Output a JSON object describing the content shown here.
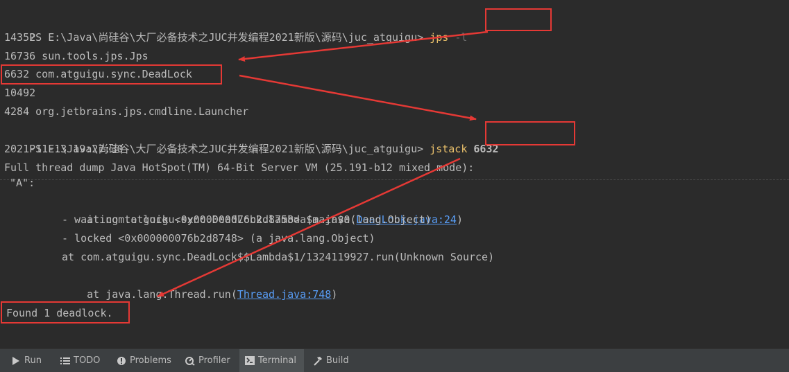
{
  "terminal": {
    "prompt": "PS E:\\Java\\尚硅谷\\大厂必备技术之JUC并发编程2021新版\\源码\\juc_atguigu>",
    "cmd1": {
      "name": "jps",
      "arg": "-l"
    },
    "jps_output": [
      "14352",
      "16736 sun.tools.jps.Jps",
      "6632 com.atguigu.sync.DeadLock",
      "10492",
      "4284 org.jetbrains.jps.cmdline.Launcher"
    ],
    "cmd2": {
      "name": "jstack",
      "arg": "6632"
    },
    "timestamp": "2021-11-13 19:27:30",
    "dump_header": "Full thread dump Java HotSpot(TM) 64-Bit Server VM (25.191-b12 mixed mode):",
    "thread_name": "\"A\":",
    "stack": {
      "l1_pre": "at com.atguigu.sync.DeadLock.lambda$main$0(",
      "l1_link": "DeadLock.java:24",
      "l1_post": ")",
      "l2": "- waiting to lock <0x000000076b2d8758> (a java.lang.Object)",
      "l3": "- locked <0x000000076b2d8748> (a java.lang.Object)",
      "l4": "at com.atguigu.sync.DeadLock$$Lambda$1/1324119927.run(Unknown Source)",
      "l5_pre": "at java.lang.Thread.run(",
      "l5_link": "Thread.java:748",
      "l5_post": ")"
    },
    "found": "Found 1 deadlock."
  },
  "annotation_color": "#e53935",
  "toolbar": {
    "tabs": [
      {
        "label": "Run",
        "icon": "run-icon"
      },
      {
        "label": "TODO",
        "icon": "list-icon"
      },
      {
        "label": "Problems",
        "icon": "problems-icon"
      },
      {
        "label": "Profiler",
        "icon": "profiler-icon"
      },
      {
        "label": "Terminal",
        "icon": "terminal-icon",
        "active": true
      },
      {
        "label": "Build",
        "icon": "hammer-icon"
      }
    ]
  }
}
